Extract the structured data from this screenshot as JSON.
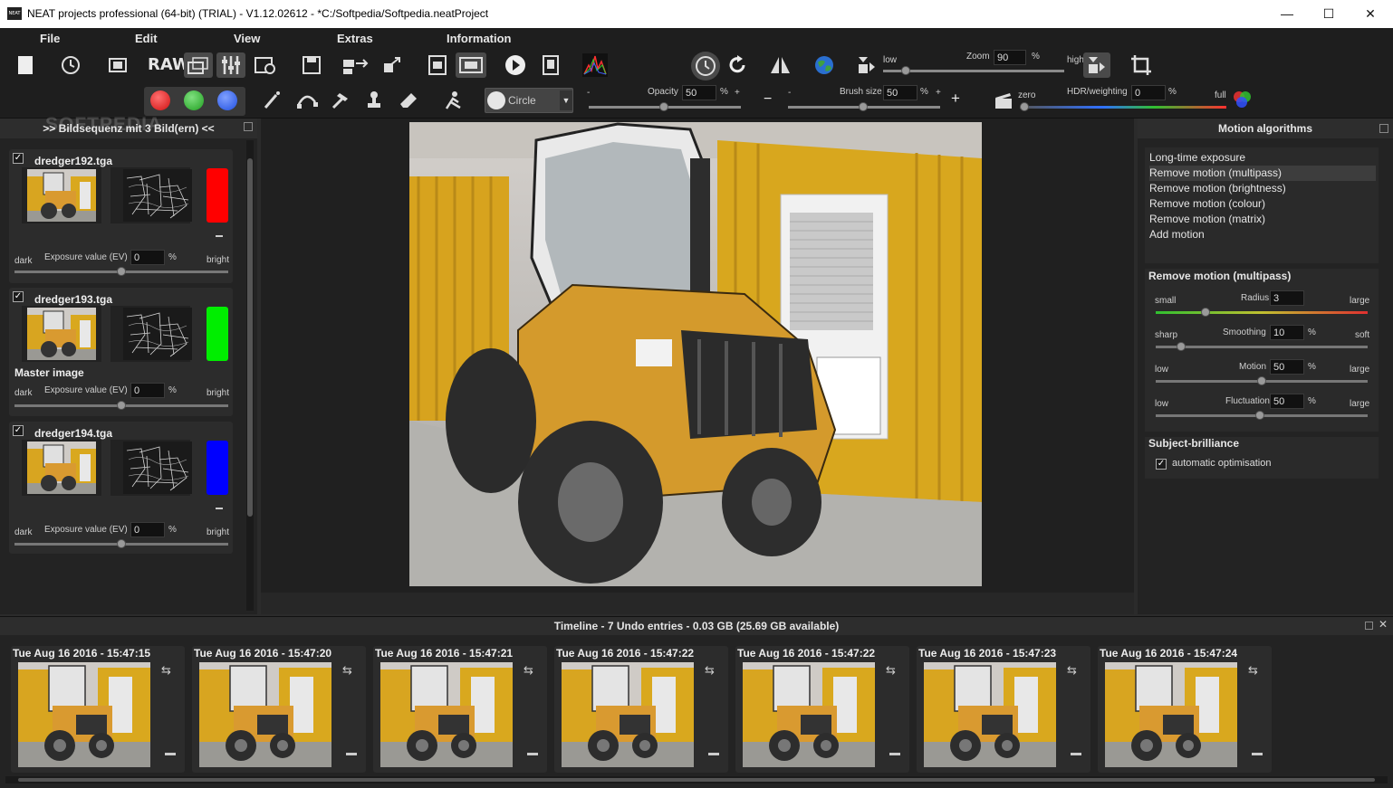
{
  "window": {
    "title": "NEAT projects professional (64-bit) (TRIAL) - V1.12.02612 - *C:/Softpedia/Softpedia.neatProject",
    "minimize": "—",
    "maximize": "☐",
    "close": "✕"
  },
  "menu": [
    "File",
    "Edit",
    "View",
    "Extras",
    "Information"
  ],
  "toolbar": {
    "raw_label": "RAW",
    "zoom_label": "Zoom",
    "zoom_value": "90",
    "zoom_unit": "%",
    "zoom_low": "low",
    "zoom_high": "high",
    "brush_shape": "Circle",
    "opacity_label": "Opacity",
    "opacity_value": "50",
    "opacity_unit": "%",
    "brush_size_label": "Brush size",
    "brush_size_value": "50",
    "brush_size_unit": "%",
    "hdr_label": "HDR/weighting",
    "hdr_value": "0",
    "hdr_unit": "%",
    "zero_label": "zero",
    "full_label": "full",
    "minus": "-",
    "plus": "+",
    "minus_big": "−",
    "plus_big": "+"
  },
  "left_panel": {
    "title": ">> Bildsequenz mit 3 Bild(ern) <<",
    "images": [
      {
        "name": "dredger192.tga",
        "color": "#ff0000",
        "master": "",
        "ev_label": "Exposure value (EV)",
        "ev_value": "0",
        "unit": "%",
        "dark": "dark",
        "bright": "bright",
        "checked": "✓"
      },
      {
        "name": "dredger193.tga",
        "color": "#00ee00",
        "master": "Master image",
        "ev_label": "Exposure value (EV)",
        "ev_value": "0",
        "unit": "%",
        "dark": "dark",
        "bright": "bright",
        "checked": "✓"
      },
      {
        "name": "dredger194.tga",
        "color": "#0000ff",
        "master": "",
        "ev_label": "Exposure value (EV)",
        "ev_value": "0",
        "unit": "%",
        "dark": "dark",
        "bright": "bright",
        "checked": "✓"
      }
    ]
  },
  "right_panel": {
    "title": "Motion algorithms",
    "algorithms": [
      "Long-time exposure",
      "Remove motion (multipass)",
      "Remove motion (brightness)",
      "Remove motion (colour)",
      "Remove motion (matrix)",
      "Add motion"
    ],
    "selected_index": 1,
    "params_title": "Remove motion (multipass)",
    "params": [
      {
        "label": "Radius",
        "value": "3",
        "unit": "",
        "left": "small",
        "right": "large"
      },
      {
        "label": "Smoothing",
        "value": "10",
        "unit": "%",
        "left": "sharp",
        "right": "soft"
      },
      {
        "label": "Motion",
        "value": "50",
        "unit": "%",
        "left": "low",
        "right": "large"
      },
      {
        "label": "Fluctuation",
        "value": "50",
        "unit": "%",
        "left": "low",
        "right": "large"
      }
    ],
    "brilliance_title": "Subject-brilliance",
    "brilliance_option": "automatic optimisation",
    "brilliance_checked": "✓"
  },
  "timeline": {
    "title": "Timeline - 7 Undo entries - 0.03 GB (25.69 GB available)",
    "entries": [
      "Tue Aug 16 2016 - 15:47:15",
      "Tue Aug 16 2016 - 15:47:20",
      "Tue Aug 16 2016 - 15:47:21",
      "Tue Aug 16 2016 - 15:47:22",
      "Tue Aug 16 2016 - 15:47:22",
      "Tue Aug 16 2016 - 15:47:23",
      "Tue Aug 16 2016 - 15:47:24"
    ],
    "restore_icon": "⇆"
  },
  "watermark": "SOFTPEDIA",
  "icons": {
    "new": "▯",
    "history": "↺",
    "compare": "⧉",
    "layers": "≣",
    "settings": "⚙",
    "save": "💾",
    "play": "▶",
    "rotate": "↻",
    "flip": "⊿",
    "crop": "⤢"
  }
}
